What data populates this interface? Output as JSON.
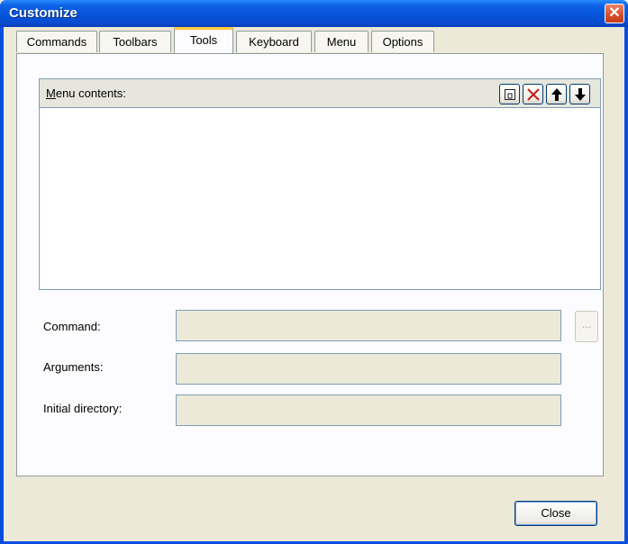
{
  "window": {
    "title": "Customize",
    "close_glyph": "✕"
  },
  "tabs": [
    {
      "label": "Commands",
      "active": false
    },
    {
      "label": "Toolbars",
      "active": false
    },
    {
      "label": "Tools",
      "active": true
    },
    {
      "label": "Keyboard",
      "active": false
    },
    {
      "label": "Menu",
      "active": false
    },
    {
      "label": "Options",
      "active": false
    }
  ],
  "menu_contents": {
    "label_underlined": "M",
    "label_rest": "enu contents:",
    "toolbar": [
      {
        "name": "new-item-icon",
        "glyph": "▢"
      },
      {
        "name": "delete-icon",
        "glyph": "✕"
      },
      {
        "name": "move-up-icon",
        "glyph": "🡅"
      },
      {
        "name": "move-down-icon",
        "glyph": "🡇"
      }
    ],
    "items": []
  },
  "form": {
    "command_label": "Command:",
    "command_value": "",
    "arguments_label": "Arguments:",
    "arguments_value": "",
    "initial_directory_label": "Initial directory:",
    "initial_directory_value": "",
    "browse_label": "..."
  },
  "footer": {
    "close_label": "Close"
  },
  "colors": {
    "titlebar": "#0653d8",
    "dialog_bg": "#ece9d8",
    "active_tab_accent": "#ffc83c",
    "delete_icon": "#c0201a"
  }
}
